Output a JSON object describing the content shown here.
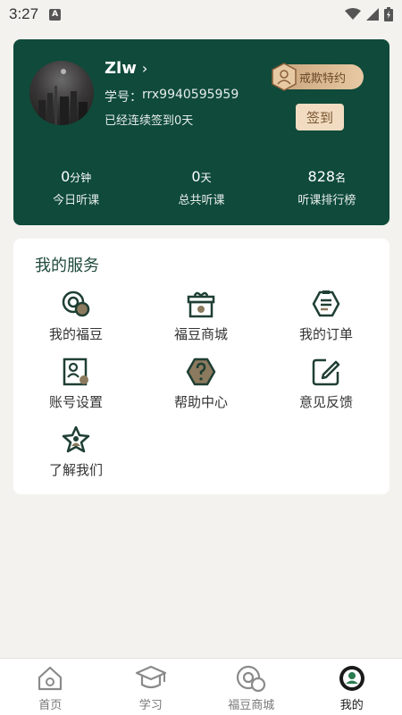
{
  "status_bar": {
    "time": "3:27",
    "notification_icon": "A"
  },
  "profile": {
    "username": "Zlw",
    "student_id_label": "学号：",
    "student_id": "rrx9940595959",
    "checkin_text": "已经连续签到0天",
    "vip_label": "戒欺特约",
    "signin_button": "签到",
    "stats": [
      {
        "value": "0",
        "unit": "分钟",
        "label": "今日听课"
      },
      {
        "value": "0",
        "unit": "天",
        "label": "总共听课"
      },
      {
        "value": "828",
        "unit": "名",
        "label": "听课排行榜"
      }
    ]
  },
  "services": {
    "title": "我的服务",
    "items": [
      {
        "label": "我的福豆",
        "icon": "beans-icon"
      },
      {
        "label": "福豆商城",
        "icon": "gift-box-icon"
      },
      {
        "label": "我的订单",
        "icon": "order-icon"
      },
      {
        "label": "账号设置",
        "icon": "account-settings-icon"
      },
      {
        "label": "帮助中心",
        "icon": "help-icon"
      },
      {
        "label": "意见反馈",
        "icon": "feedback-icon"
      },
      {
        "label": "了解我们",
        "icon": "about-us-icon"
      }
    ]
  },
  "bottom_nav": {
    "items": [
      {
        "label": "首页",
        "icon": "home-icon"
      },
      {
        "label": "学习",
        "icon": "graduation-cap-icon"
      },
      {
        "label": "福豆商城",
        "icon": "beans-icon"
      },
      {
        "label": "我的",
        "icon": "profile-icon"
      }
    ],
    "active": "我的"
  },
  "colors": {
    "primary_green": "#0f4a3a",
    "gold": "#c9a37a",
    "background": "#f3f2ee"
  }
}
